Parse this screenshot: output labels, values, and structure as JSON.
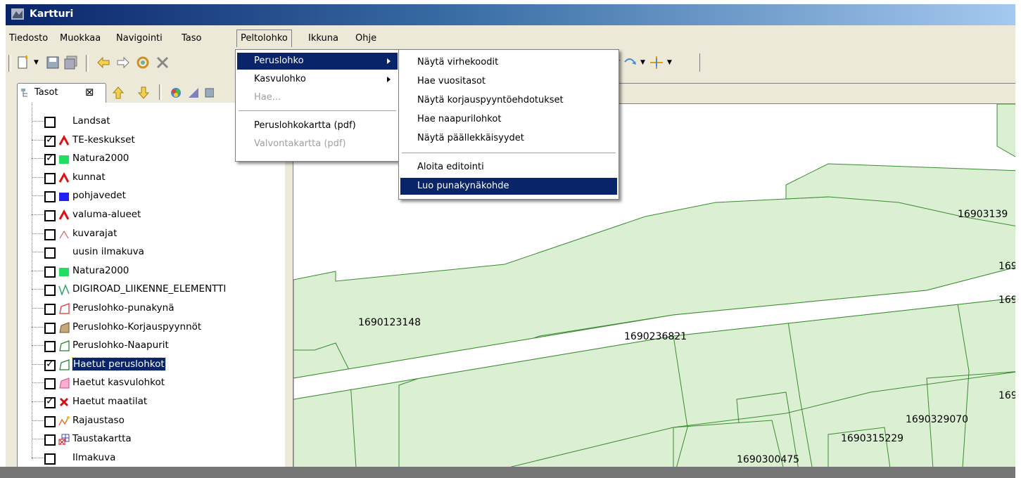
{
  "window": {
    "title": "Kartturi"
  },
  "menubar": [
    "Tiedosto",
    "Muokkaa",
    "Navigointi",
    "Taso",
    "Peltolohko",
    "Ikkuna",
    "Ohje"
  ],
  "peltolohko_menu": {
    "items": [
      "Peruslohko",
      "Kasvulohko",
      "Hae...",
      "Peruslohkokartta (pdf)",
      "Valvontakartta (pdf)"
    ]
  },
  "peruslohko_submenu": {
    "items": [
      "Näytä virhekoodit",
      "Hae vuositasot",
      "Näytä korjauspyyntöehdotukset",
      "Hae naapurilohkot",
      "Näytä päällekkäisyydet",
      "Aloita editointi",
      "Luo punakynäkohde"
    ]
  },
  "layers_panel": {
    "tab_label": "Tasot",
    "tab_close": "⊠",
    "layers": [
      {
        "name": "Landsat",
        "checked": false,
        "symbol": "none"
      },
      {
        "name": "TE-keskukset",
        "checked": true,
        "symbol": "red-caret"
      },
      {
        "name": "Natura2000",
        "checked": true,
        "symbol": "green-square"
      },
      {
        "name": "kunnat",
        "checked": false,
        "symbol": "red-caret"
      },
      {
        "name": "pohjavedet",
        "checked": false,
        "symbol": "blue-square"
      },
      {
        "name": "valuma-alueet",
        "checked": false,
        "symbol": "red-caret"
      },
      {
        "name": "kuvarajat",
        "checked": false,
        "symbol": "thin-red-caret"
      },
      {
        "name": "uusin ilmakuva",
        "checked": false,
        "symbol": "none"
      },
      {
        "name": "Natura2000",
        "checked": false,
        "symbol": "green-square"
      },
      {
        "name": "DIGIROAD_LIIKENNE_ELEMENTTI",
        "checked": false,
        "symbol": "green-zigzag"
      },
      {
        "name": "Peruslohko-punakynä",
        "checked": false,
        "symbol": "red-polygon"
      },
      {
        "name": "Peruslohko-Korjauspyynnöt",
        "checked": false,
        "symbol": "tan-polygon"
      },
      {
        "name": "Peruslohko-Naapurit",
        "checked": false,
        "symbol": "green-polygon"
      },
      {
        "name": "Haetut peruslohkot",
        "checked": true,
        "symbol": "green-polygon",
        "selected": true
      },
      {
        "name": "Haetut kasvulohkot",
        "checked": false,
        "symbol": "pink-polygon"
      },
      {
        "name": "Haetut maatilat",
        "checked": true,
        "symbol": "red-cross"
      },
      {
        "name": "Rajaustaso",
        "checked": false,
        "symbol": "orange-zigzag"
      },
      {
        "name": "Taustakartta",
        "checked": false,
        "symbol": "grid-icon"
      },
      {
        "name": "Ilmakuva",
        "checked": false,
        "symbol": "none"
      }
    ]
  },
  "map": {
    "parcel_labels": [
      "1690123148",
      "1690236821",
      "16903139",
      "1690",
      "1690",
      "1690",
      "1690329070",
      "1690315229",
      "1690300475"
    ]
  },
  "colors": {
    "selection": "#0a246a",
    "parcel_fill": "#dbf0d2",
    "parcel_stroke": "#3a8a30"
  }
}
